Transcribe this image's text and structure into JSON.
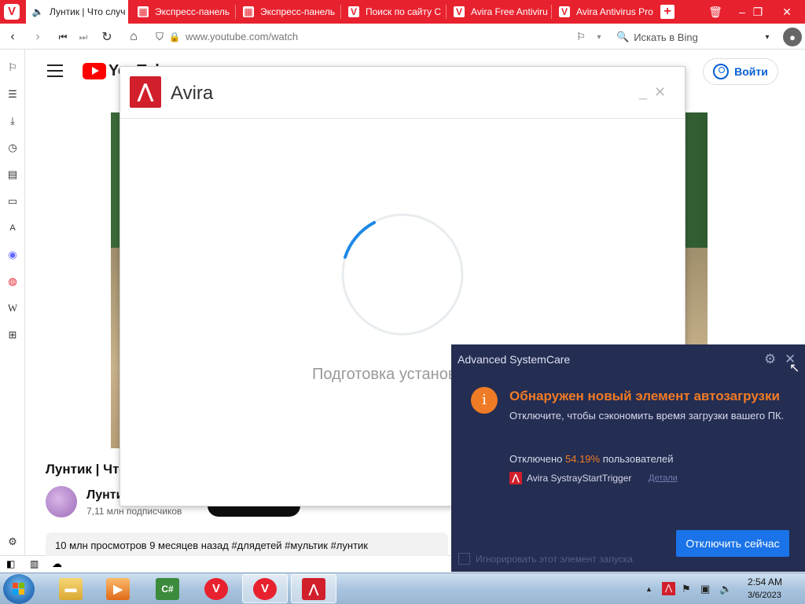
{
  "browser": {
    "tabs": [
      {
        "label": "Лунтик | Что случ",
        "icon": "speaker-icon",
        "active": true
      },
      {
        "label": "Экспресс-панель",
        "icon": "grid-icon"
      },
      {
        "label": "Экспресс-панель",
        "icon": "grid-icon"
      },
      {
        "label": "Поиск по сайту С",
        "icon": "vivaldi-icon"
      },
      {
        "label": "Avira Free Antiviru",
        "icon": "vivaldi-icon"
      },
      {
        "label": "Avira Antivirus Pro",
        "icon": "vivaldi-icon"
      }
    ],
    "url": "www.youtube.com/watch",
    "search_placeholder": "Искать в Bing"
  },
  "youtube": {
    "logo_text": "YouTube",
    "signin_label": "Войти",
    "video_title": "Лунтик | Что случилось",
    "channel_name": "Лунтик",
    "subscribers": "7,11 млн подписчиков",
    "description": "10 млн просмотров  9 месяцев назад  #длядетей #мультик #лунтик"
  },
  "avira": {
    "title": "Avira",
    "status": "Подготовка установки"
  },
  "asc": {
    "app_title": "Advanced SystemCare",
    "headline": "Обнаружен новый элемент автозагрузки",
    "description": "Отключите, чтобы сэкономить время загрузки вашего ПК.",
    "stat_prefix": "Отключено",
    "stat_percent": "54.19%",
    "stat_suffix": "пользователей",
    "item_name": "Avira SystrayStartTrigger",
    "details_link": "Детали",
    "action_button": "Отключить сейчас",
    "ignore_label": "Игнорировать этот элемент запуска",
    "accent_color": "#f07b26"
  },
  "taskbar": {
    "time": "2:54 AM",
    "date": "3/6/2023"
  }
}
